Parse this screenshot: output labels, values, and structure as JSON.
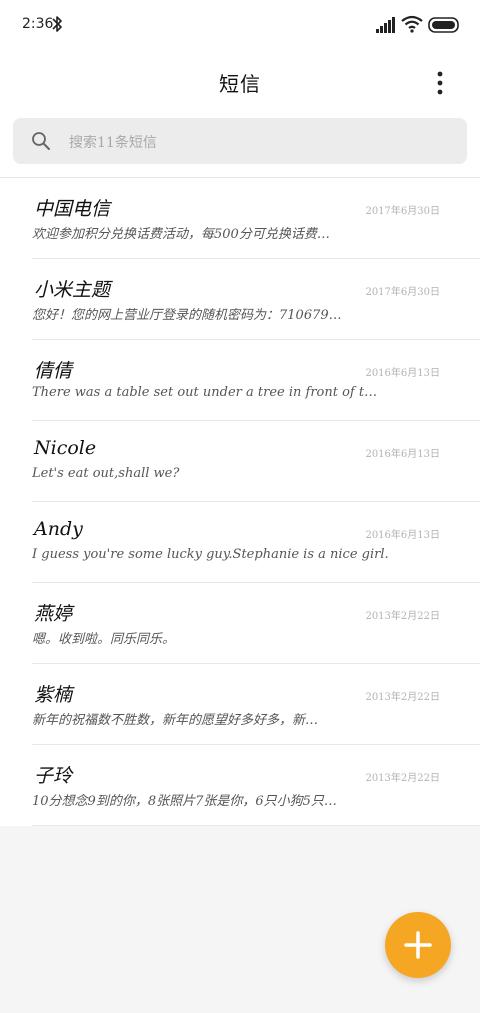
{
  "status_bar": {
    "time": "2:36",
    "icons": [
      "bluetooth-icon",
      "signal-icon",
      "wifi-icon",
      "battery-icon"
    ]
  },
  "header": {
    "title": "短信",
    "menu_icon": "more-vertical-icon"
  },
  "search": {
    "placeholder": "搜索11条短信",
    "icon": "search-icon"
  },
  "messages": [
    {
      "name": "中国电信",
      "date": "2017年6月30日",
      "preview": "欢迎参加积分兑换话费活动，每500分可兑换话费…"
    },
    {
      "name": "小米主题",
      "date": "2017年6月30日",
      "preview": "您好！您的网上营业厅登录的随机密码为：710679…"
    },
    {
      "name": "倩倩",
      "date": "2016年6月13日",
      "preview": "There was a table set out under a tree in front of t…"
    },
    {
      "name": "Nicole",
      "date": "2016年6月13日",
      "preview": "Let's eat out,shall we?"
    },
    {
      "name": "Andy",
      "date": "2016年6月13日",
      "preview": "I guess you're some lucky guy.Stephanie is a nice girl."
    },
    {
      "name": "燕婷",
      "date": "2013年2月22日",
      "preview": "嗯。收到啦。同乐同乐。"
    },
    {
      "name": "紫楠",
      "date": "2013年2月22日",
      "preview": "新年的祝福数不胜数，新年的愿望好多好多，新…"
    },
    {
      "name": "子玲",
      "date": "2013年2月22日",
      "preview": "10分想念9到的你，8张照片7张是你，6只小狗5只…"
    }
  ],
  "fab": {
    "icon": "plus-icon",
    "color": "#f5a623"
  },
  "colors": {
    "accent": "#f5a623",
    "background": "#f5f5f5",
    "search_background": "#ececec"
  }
}
